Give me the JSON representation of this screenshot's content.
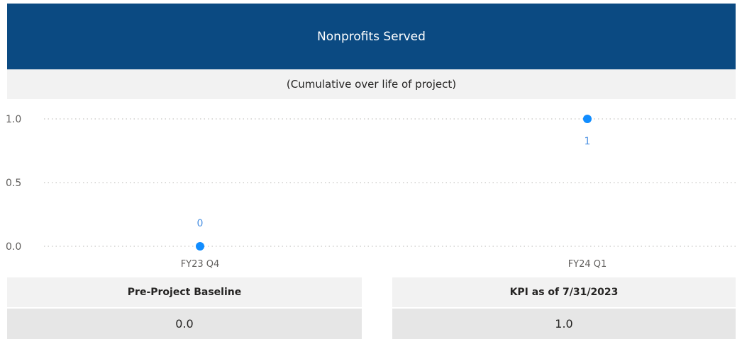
{
  "colors": {
    "header_bg": "#0b4a82",
    "series": "#118dff",
    "data_label": "#4a90e2"
  },
  "header": {
    "title": "Nonprofits Served"
  },
  "subheader": {
    "text": "(Cumulative over life of project)"
  },
  "chart_data": {
    "type": "scatter",
    "title": "Nonprofits Served",
    "subtitle": "(Cumulative over life of project)",
    "categories": [
      "FY23 Q4",
      "FY24 Q1"
    ],
    "values": [
      0,
      1
    ],
    "data_labels": [
      "0",
      "1"
    ],
    "y_ticks": [
      "0.0",
      "0.5",
      "1.0"
    ],
    "ylim": [
      0,
      1
    ],
    "grid": true,
    "xlabel": "",
    "ylabel": ""
  },
  "cards": {
    "baseline": {
      "title": "Pre-Project Baseline",
      "value": "0.0"
    },
    "kpi": {
      "title": "KPI as of 7/31/2023",
      "value": "1.0"
    }
  }
}
